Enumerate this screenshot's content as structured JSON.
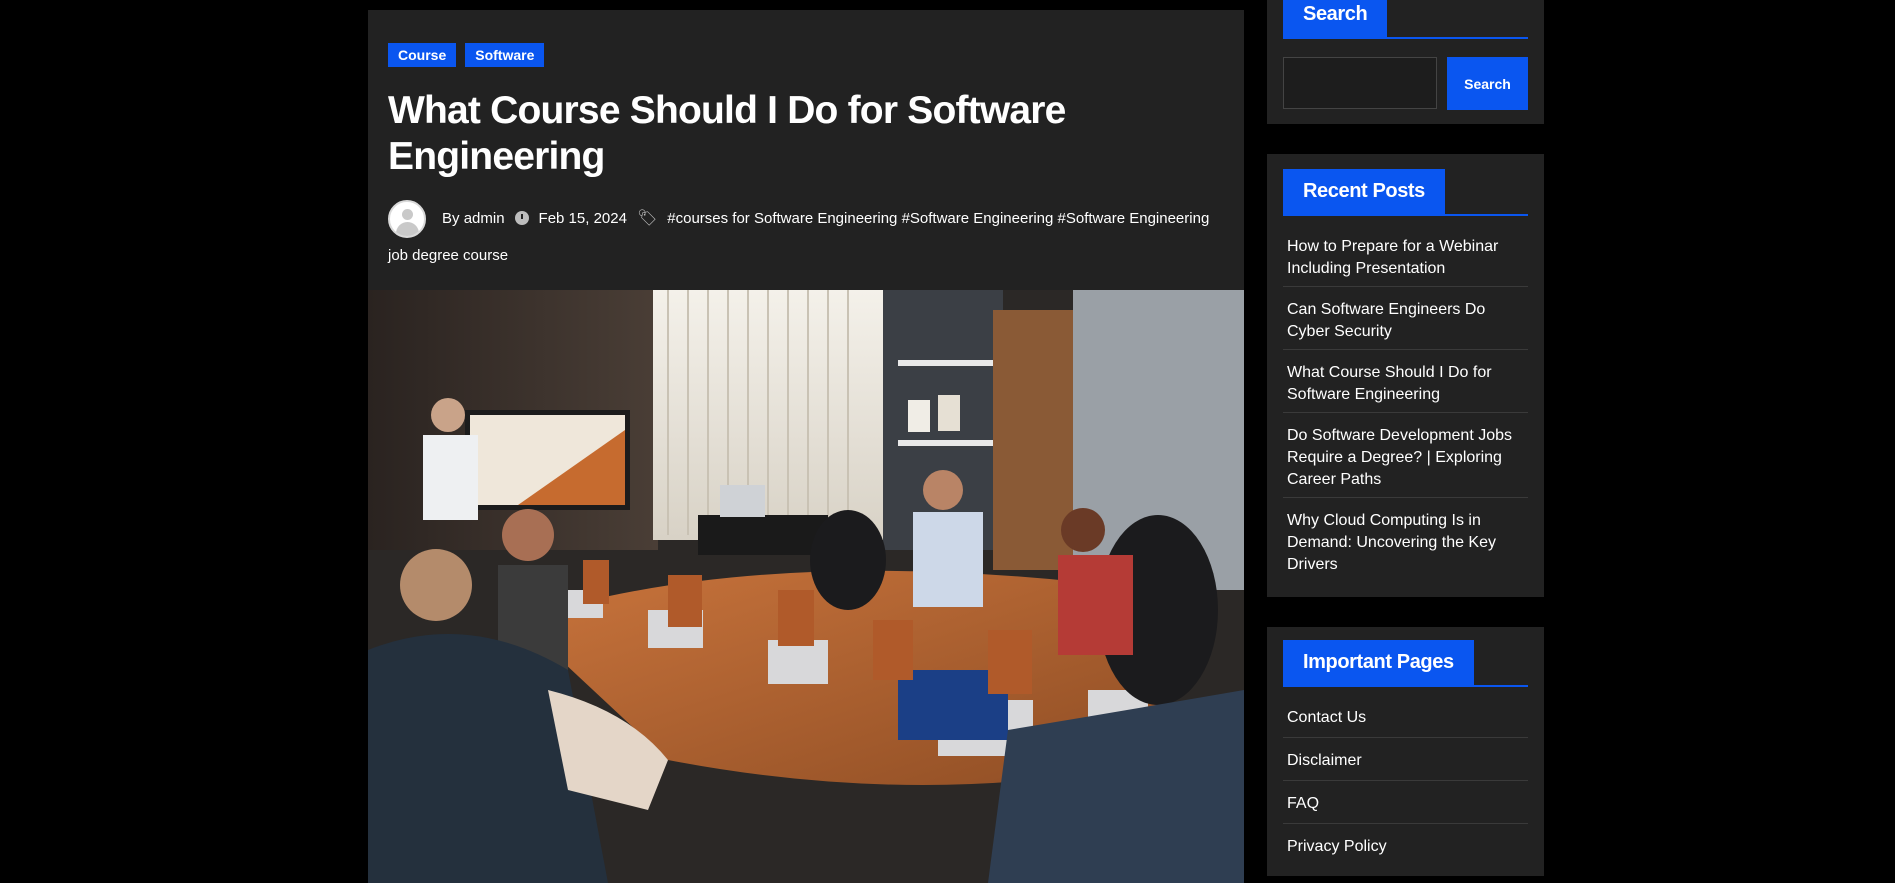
{
  "article": {
    "categories": [
      "Course",
      "Software"
    ],
    "title": "What Course Should I Do for Software Engineering",
    "author_prefix": "By",
    "author": "admin",
    "date": "Feb 15, 2024",
    "tags": [
      "#courses for Software Engineering",
      "#Software Engineering",
      "#Software Engineering job degree course"
    ]
  },
  "sidebar": {
    "search": {
      "heading": "Search",
      "input_value": "",
      "button_label": "Search"
    },
    "recent_posts": {
      "heading": "Recent Posts",
      "items": [
        "How to Prepare for a Webinar Including Presentation",
        "Can Software Engineers Do Cyber Security",
        "What Course Should I Do for Software Engineering",
        "Do Software Development Jobs Require a Degree? | Exploring Career Paths",
        "Why Cloud Computing Is in Demand: Uncovering the Key Drivers"
      ]
    },
    "important_pages": {
      "heading": "Important Pages",
      "items": [
        "Contact Us",
        "Disclaimer",
        "FAQ",
        "Privacy Policy"
      ]
    }
  },
  "colors": {
    "accent": "#0a56f0",
    "card_bg": "#222222",
    "page_bg": "#000000"
  }
}
